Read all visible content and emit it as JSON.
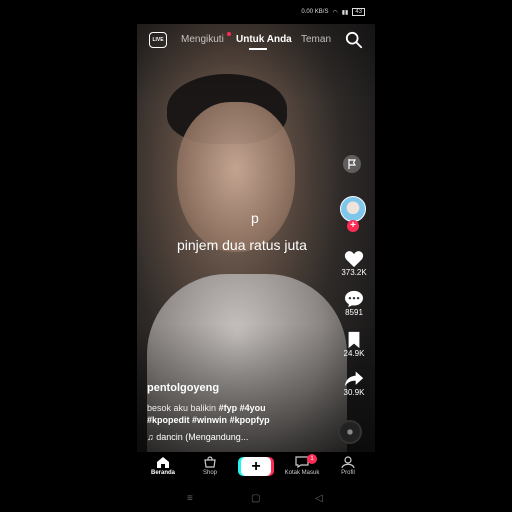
{
  "status": {
    "speed": "0.00 KB/S",
    "battery": "43"
  },
  "topnav": {
    "live_label": "LIVE",
    "tabs": [
      {
        "label": "Mengikuti"
      },
      {
        "label": "Untuk Anda"
      },
      {
        "label": "Teman"
      }
    ]
  },
  "video": {
    "caption_letter": "p",
    "caption_text": "pinjem dua ratus juta"
  },
  "actions": {
    "likes": "373.2K",
    "comments": "8591",
    "saves": "24.9K",
    "shares": "30.9K"
  },
  "post": {
    "username": "pentolgoyeng",
    "desc_text": "besok aku balikin",
    "hashtags_line1": [
      "#fyp",
      "#4you"
    ],
    "hashtags_line2": [
      "#kpopedit",
      "#winwin",
      "#kpopfyp"
    ],
    "music": "♫ dancin (Mengandung..."
  },
  "bottomnav": {
    "items": [
      {
        "label": "Beranda"
      },
      {
        "label": "Shop"
      },
      {
        "label": "Kotak Masuk"
      },
      {
        "label": "Profil"
      }
    ],
    "inbox_badge": "1"
  },
  "colors": {
    "accent": "#fe2c55",
    "cyan": "#25f4ee"
  }
}
